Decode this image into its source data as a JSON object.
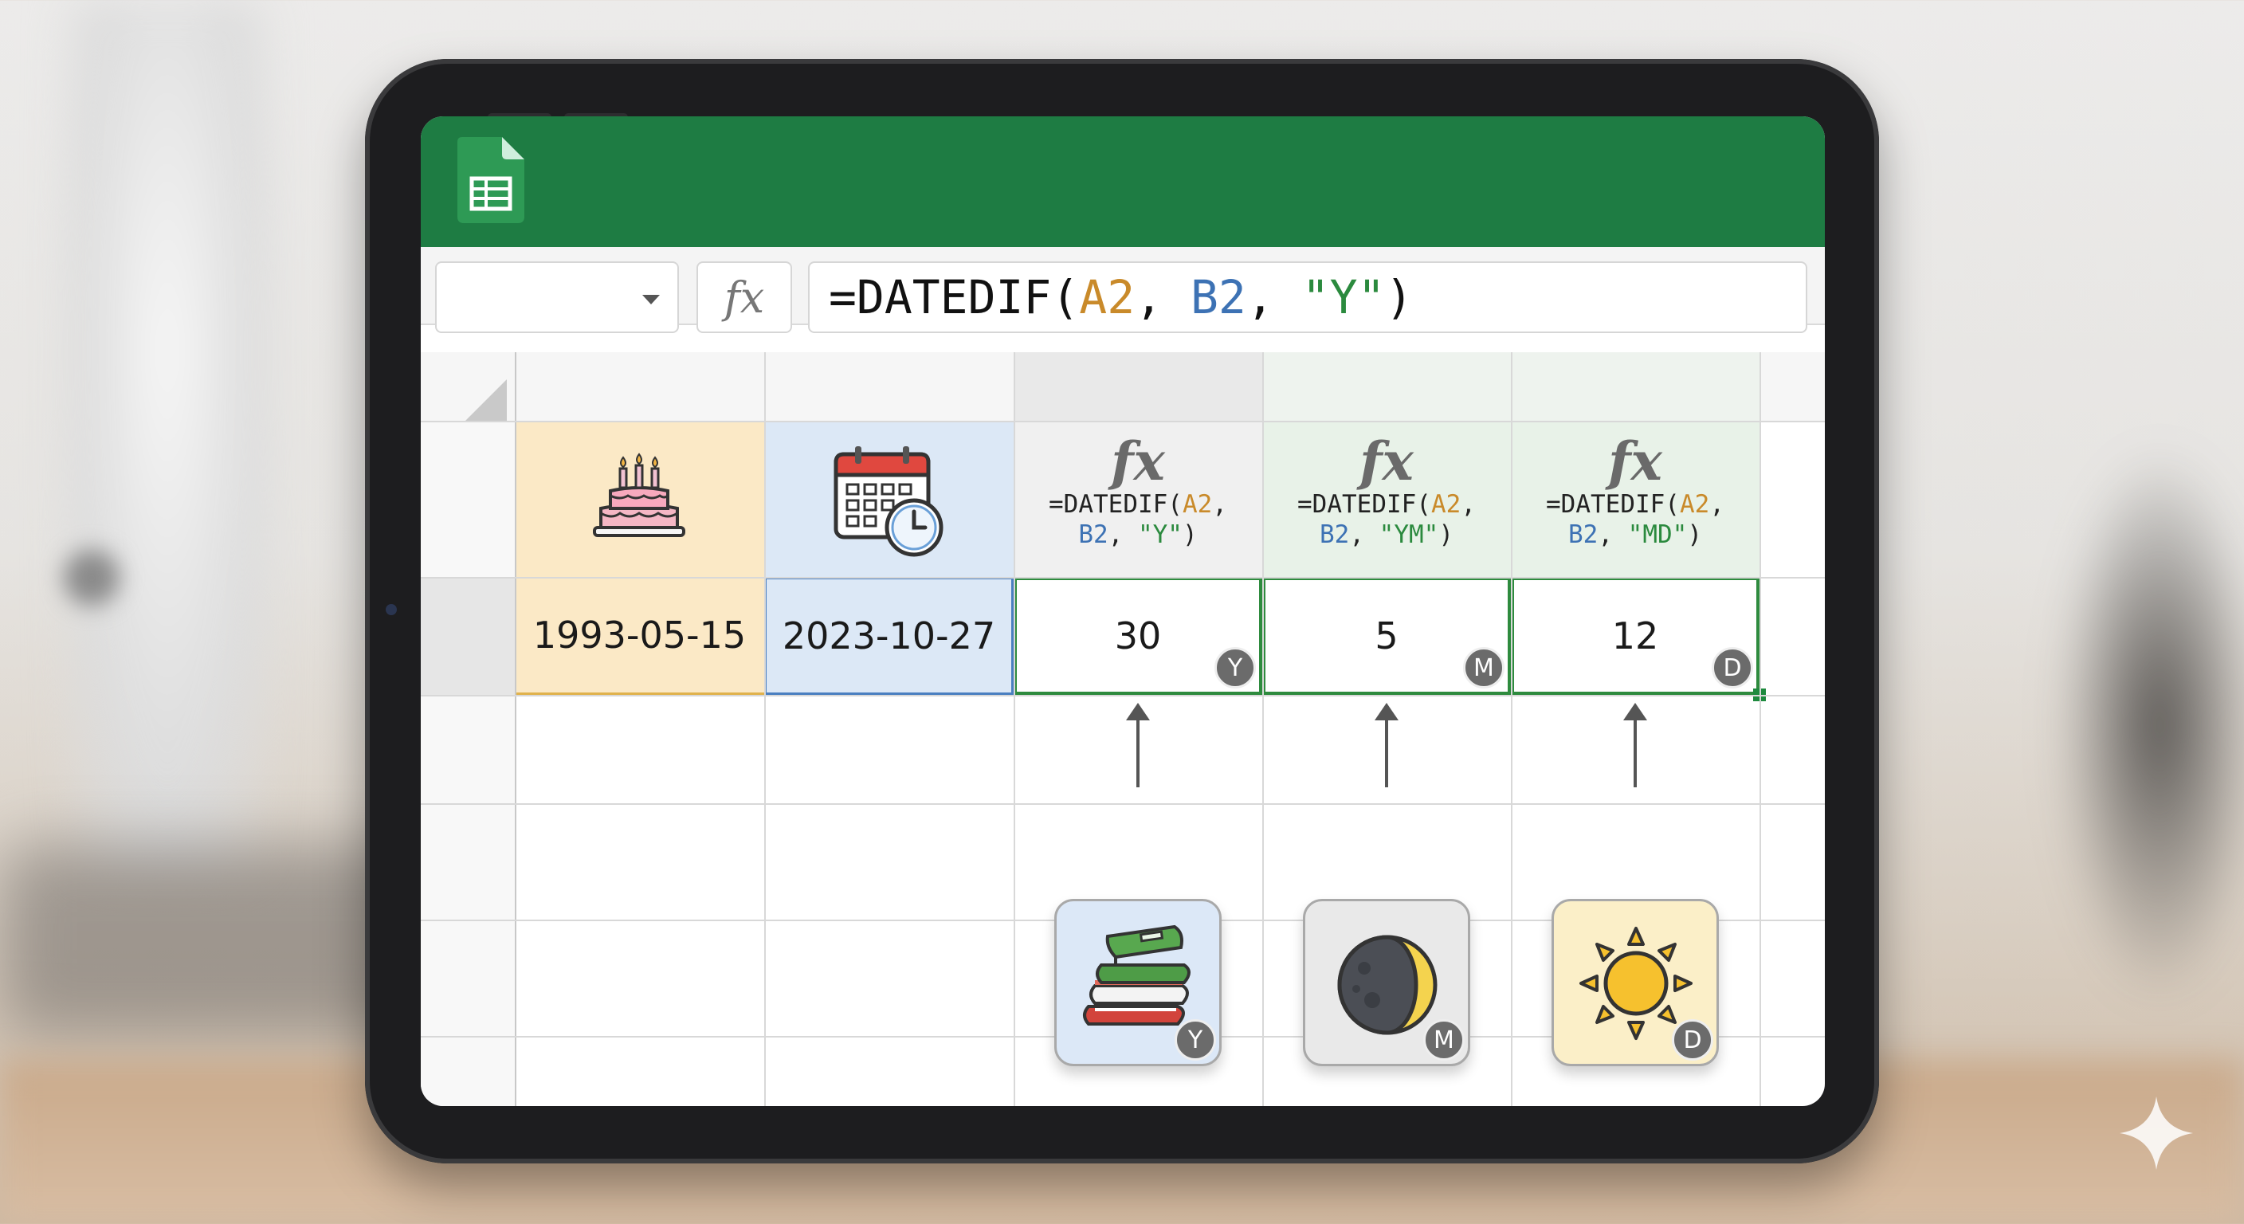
{
  "app": {
    "name": "Google Sheets",
    "logo_icon": "sheets-logo-icon",
    "header_color": "#1e7c43"
  },
  "formula_bar": {
    "name_box_value": "",
    "fx_label": "fx",
    "formula_parts": {
      "fn": "=DATEDIF(",
      "a2": "A2",
      "sep1": ", ",
      "b2": "B2",
      "sep2": ", ",
      "str": "\"Y\"",
      "close": ")"
    }
  },
  "sheet": {
    "header_icons": {
      "birth": "birthday-cake-icon",
      "end": "calendar-clock-icon"
    },
    "formula_headers": [
      {
        "fx": "fx",
        "line1_fn": "=DATEDIF(",
        "line1_a2": "A2",
        "line1_sep": ",",
        "line2_b2": "B2",
        "line2_sep": ", ",
        "line2_str": "\"Y\"",
        "line2_close": ")"
      },
      {
        "fx": "fx",
        "line1_fn": "=DATEDIF(",
        "line1_a2": "A2",
        "line1_sep": ",",
        "line2_b2": "B2",
        "line2_sep": ", ",
        "line2_str": "\"YM\"",
        "line2_close": ")"
      },
      {
        "fx": "fx",
        "line1_fn": "=DATEDIF(",
        "line1_a2": "A2",
        "line1_sep": ",",
        "line2_b2": "B2",
        "line2_sep": ", ",
        "line2_str": "\"MD\"",
        "line2_close": ")"
      }
    ],
    "row": {
      "start_date": "1993-05-15",
      "end_date": "2023-10-27",
      "results": [
        {
          "value": "30",
          "badge": "Y"
        },
        {
          "value": "5",
          "badge": "M"
        },
        {
          "value": "12",
          "badge": "D"
        }
      ]
    },
    "unit_tiles": [
      {
        "icon": "stack-of-books-icon",
        "badge": "Y"
      },
      {
        "icon": "crescent-moon-icon",
        "badge": "M"
      },
      {
        "icon": "sun-icon",
        "badge": "D"
      }
    ],
    "colors": {
      "a2_ref": "#c98a2a",
      "b2_ref": "#3d72b4",
      "string_arg": "#2b8a3e",
      "start_col_bg": "#fbe9c6",
      "end_col_bg": "#dce8f6",
      "selection_border": "#2e8b3e"
    }
  }
}
